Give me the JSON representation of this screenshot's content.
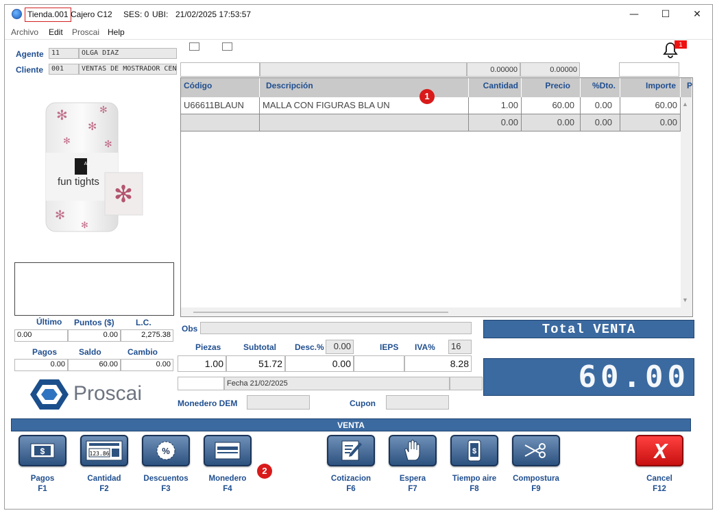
{
  "titlebar": {
    "store": "Tienda.001",
    "cashier": "Cajero C12",
    "session": "SES: 0",
    "ubi_label": "UBI:",
    "datetime": "21/02/2025 17:53:57",
    "minimize": "—",
    "maximize": "☐",
    "close": "✕"
  },
  "menu": {
    "items": [
      "Archivo",
      "Edit",
      "Proscai",
      "Help"
    ]
  },
  "customer": {
    "agent_label": "Agente",
    "agent_code": "11",
    "agent_name": "OLGA DIAZ",
    "client_label": "Cliente",
    "client_code": "001",
    "client_name": "VENTAS DE MOSTRADOR CENTR"
  },
  "product_image": {
    "brand_text": "fun tights",
    "box_mark": "AV"
  },
  "notifications": {
    "count": "1"
  },
  "entry_row": {
    "qty_value": "0.00000",
    "price_value": "0.00000"
  },
  "grid": {
    "columns": [
      "Código",
      "Descripción",
      "Cantidad",
      "Precio",
      "%Dto.",
      "Importe",
      "P"
    ],
    "rows": [
      [
        "U66611BLAUN",
        "MALLA CON FIGURAS BLA UN",
        "1.00",
        "60.00",
        "0.00",
        "60.00"
      ],
      [
        "",
        "",
        "0.00",
        "0.00",
        "0.00",
        "0.00"
      ]
    ],
    "scroll_up": "▲",
    "scroll_down": "▼"
  },
  "markers": {
    "one": "1",
    "two": "2"
  },
  "points": {
    "ultimo_label": "Último",
    "puntos_label": "Puntos ($)",
    "lc_label": "L.C.",
    "ultimo_value": "0.00",
    "puntos_value": "0.00",
    "lc_value": "2,275.38",
    "pagos_label": "Pagos",
    "saldo_label": "Saldo",
    "cambio_label": "Cambio",
    "pagos_value": "0.00",
    "saldo_value": "60.00",
    "cambio_value": "0.00"
  },
  "logo": {
    "text": "Proscai"
  },
  "summary": {
    "obs_label": "Obs",
    "piezas_label": "Piezas",
    "subtotal_label": "Subtotal",
    "desc_label": "Desc.%",
    "desc_pct": "0.00",
    "ieps_label": "IEPS",
    "iva_label": "IVA%",
    "iva_pct": "16",
    "piezas_value": "1.00",
    "subtotal_value": "51.72",
    "desc_value": "0.00",
    "ieps_value": "",
    "iva_value": "8.28",
    "fecha": "Fecha 21/02/2025",
    "monedero_label": "Monedero DEM",
    "cupon_label": "Cupon"
  },
  "total": {
    "label": "Total VENTA",
    "amount": "60.00"
  },
  "mode_bar": {
    "label": "VENTA"
  },
  "function_keys": [
    {
      "label": "Pagos",
      "key": "F1"
    },
    {
      "label": "Cantidad",
      "key": "F2"
    },
    {
      "label": "Descuentos",
      "key": "F3"
    },
    {
      "label": "Monedero",
      "key": "F4"
    },
    {
      "label": "Cotizacion",
      "key": "F6"
    },
    {
      "label": "Espera",
      "key": "F7"
    },
    {
      "label": "Tiempo aire",
      "key": "F8"
    },
    {
      "label": "Compostura",
      "key": "F9"
    },
    {
      "label": "Cancel",
      "key": "F12"
    }
  ],
  "icons": {
    "pagos": "dollar-bill-icon",
    "cantidad": "calculator-icon",
    "descuentos": "percent-icon",
    "monedero": "card-icon",
    "cotizacion": "document-pen-icon",
    "espera": "hand-icon",
    "tiempo_aire": "phone-dollar-icon",
    "compostura": "scissors-icon",
    "cancel": "x-icon",
    "bell": "bell-icon"
  },
  "colors": {
    "accent": "#3b6aa0",
    "label_blue": "#1f4e8f",
    "alert_red": "#d91a1a"
  }
}
